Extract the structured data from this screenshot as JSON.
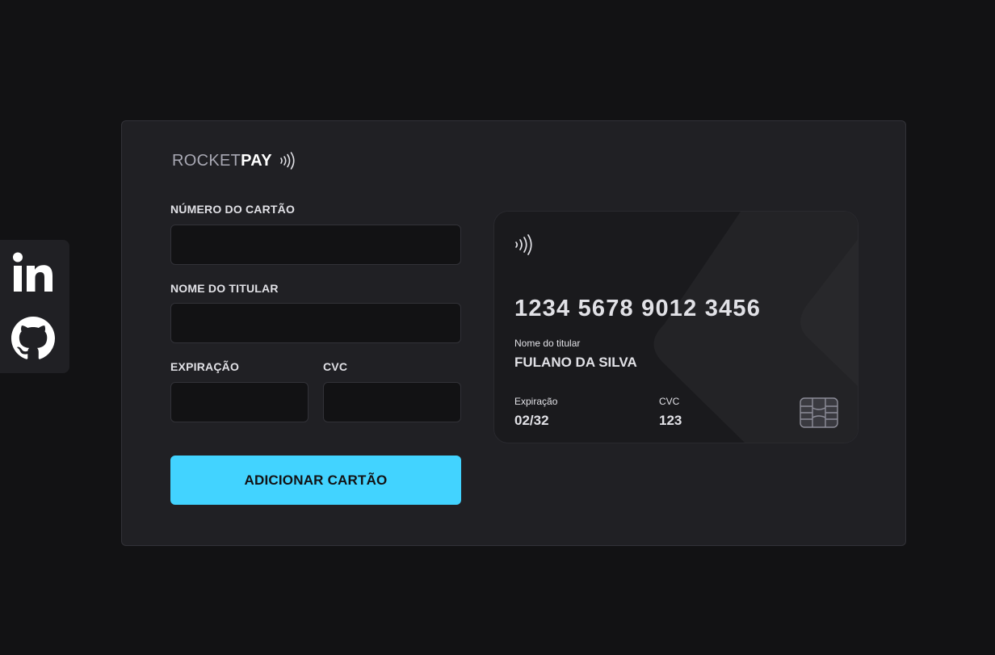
{
  "social": {
    "linkedin_icon": "linkedin-icon",
    "github_icon": "github-icon"
  },
  "logo": {
    "rocket": "ROCKET",
    "pay": "PAY",
    "icon": "contactless-icon"
  },
  "form": {
    "card_number_label": "NÚMERO DO CARTÃO",
    "card_number_value": "",
    "holder_label": "NOME DO TITULAR",
    "holder_value": "",
    "expiration_label": "EXPIRAÇÃO",
    "expiration_value": "",
    "cvc_label": "CVC",
    "cvc_value": "",
    "submit_label": "ADICIONAR CARTÃO"
  },
  "card": {
    "number": "1234 5678 9012 3456",
    "holder_label": "Nome do titular",
    "holder": "FULANO DA SILVA",
    "expiration_label": "Expiração",
    "expiration": "02/32",
    "cvc_label": "CVC",
    "cvc": "123",
    "chip_icon": "card-chip-icon"
  },
  "colors": {
    "background": "#121214",
    "panel": "#202024",
    "accent": "#42d3ff",
    "text": "#e1e1e6"
  }
}
